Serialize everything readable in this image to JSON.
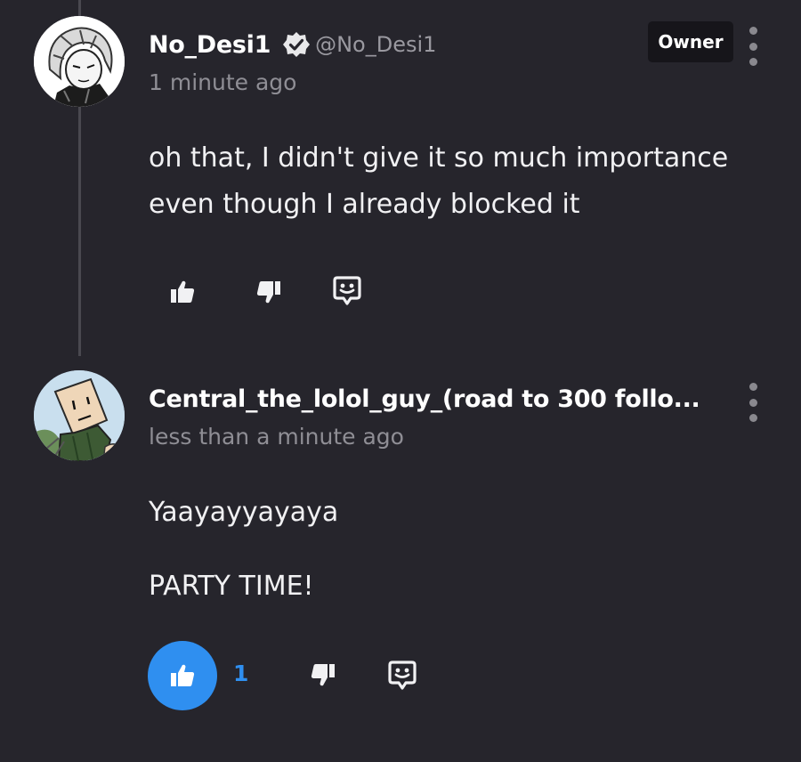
{
  "comments": [
    {
      "username": "No_Desi1",
      "verified": true,
      "handle": "@No_Desi1",
      "timestamp": "1 minute ago",
      "badge": "Owner",
      "body_lines": [
        "oh that, I didn't give it so much importance",
        "even though I already blocked it"
      ],
      "actions": {
        "like_icon": "thumbs-up-icon",
        "dislike_icon": "thumbs-down-icon",
        "reply_icon": "reply-icon",
        "liked": false
      }
    },
    {
      "username": "Central_the_lolol_guy_(road to 300 follo...",
      "verified": false,
      "handle": "",
      "timestamp": "less than a minute ago",
      "badge": "",
      "body_paragraphs": [
        "Yaayayyayaya",
        "PARTY TIME!"
      ],
      "actions": {
        "like_icon": "thumbs-up-icon",
        "like_count": "1",
        "dislike_icon": "thumbs-down-icon",
        "reply_icon": "reply-icon",
        "liked": true
      }
    }
  ],
  "colors": {
    "background": "#26252c",
    "accent": "#2f8ff0",
    "badge_background": "#16151a",
    "secondary_text": "#8f8e95"
  }
}
